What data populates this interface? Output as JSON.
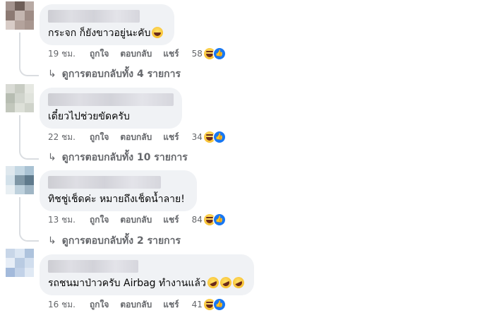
{
  "labels": {
    "like": "ถูกใจ",
    "reply": "ตอบกลับ",
    "share": "แชร์"
  },
  "comments": [
    {
      "text": "กระจก ก็ยังขาวอยู่นะคับ",
      "time": "19 ชม.",
      "reaction_count": "58",
      "replies_label": "ดูการตอบกลับทั้ง 4 รายการ",
      "avatar_colors": [
        "#a3938e",
        "#6e5e58",
        "#b8aaa4",
        "#8c7a73",
        "#c4b6b0",
        "#9e8c85",
        "#d8ccc7",
        "#b4a39c",
        "#a8968f"
      ]
    },
    {
      "text": "เดี๋ยวไปช่วยขัดครับ",
      "time": "22 ชม.",
      "reaction_count": "34",
      "replies_label": "ดูการตอบกลับทั้ง 10 รายการ",
      "avatar_colors": [
        "#d9dbd5",
        "#c8ccc3",
        "#e6e8e2",
        "#b7bdb2",
        "#d0d4cc",
        "#e0e3dc",
        "#c2c7bc",
        "#dde0d8",
        "#cfd3ca"
      ]
    },
    {
      "text": "ทิชชู่เช็ดค่ะ หมายถึงเช็ดน้ำลาย!",
      "time": "13 ชม.",
      "reaction_count": "84",
      "replies_label": "ดูการตอบกลับทั้ง 2 รายการ",
      "avatar_colors": [
        "#dfe8ee",
        "#c4d7e3",
        "#a9c2d3",
        "#d3e1ea",
        "#7f97a6",
        "#5f7a8c",
        "#e8eff3",
        "#bed1dd",
        "#9fb5c4"
      ]
    },
    {
      "text": "รถชนมาป่าวครับ Airbag ทำงานแล้ว",
      "time": "16 ชม.",
      "reaction_count": "41",
      "replies_label": "",
      "avatar_colors": [
        "#c8d6e8",
        "#dbe6f3",
        "#aec3dd",
        "#e7eef7",
        "#b9cbe2",
        "#d1deee",
        "#a3badb",
        "#c2d2e8",
        "#e0e9f4"
      ]
    }
  ]
}
